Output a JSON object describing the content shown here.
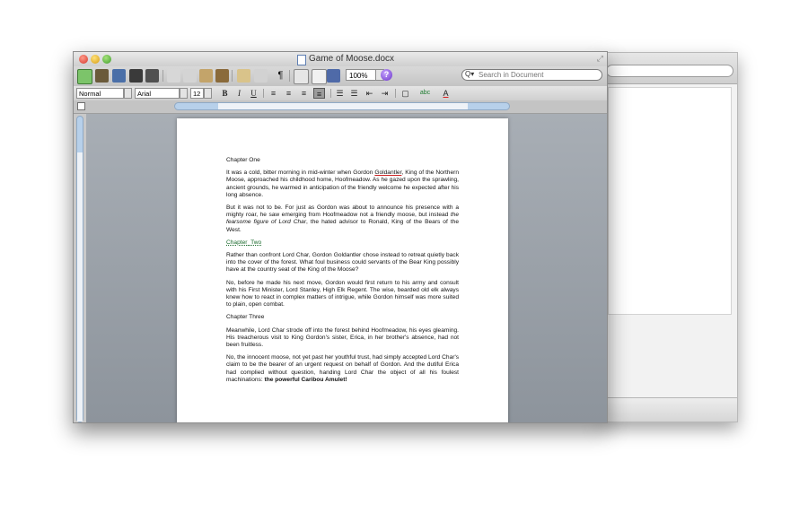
{
  "window": {
    "title": "Game of Moose.docx"
  },
  "toolbar": {
    "zoom": "100%",
    "search_placeholder": "Search in Document"
  },
  "format": {
    "style": "Normal",
    "font": "Arial",
    "size": "12",
    "bold": "B",
    "italic": "I",
    "underline": "U"
  },
  "document": {
    "chapter1_heading": "Chapter One",
    "p1a": "It was a cold, bitter morning in mid-winter when Gordon ",
    "p1_name": "Goldantler",
    "p1b": ", King of the Northern Moose, approached his childhood home, Hoofmeadow. As he gazed upon the sprawling, ancient grounds, he warmed in anticipation of the friendly welcome he expected after his long absence.",
    "p2a": "But it was not to be. For just as Gordon was about to announce his presence with a mighty roar, he saw emerging from Hoofmeadow not a friendly moose, but instead ",
    "p2_em": "the fearsome figure of Lord Char",
    "p2b": ", the hated advisor to Ronald, King of the Bears of the West.",
    "chapter2_heading": "Chapter_Two",
    "p3": "Rather than confront Lord Char, Gordon Goldantler chose instead to retreat quietly back into the cover of the forest. What foul business could servants of the Bear King possibly have at the country seat of the King of the Moose?",
    "p4": "No, before he made his next move, Gordon would first return to his army and consult with his First Minister, Lord Stanley, High Elk Regent. The wise, bearded old elk always knew how to react in complex matters of intrigue, while Gordon himself was more suited to plain, open combat.",
    "chapter3_heading": "Chapter Three",
    "p5": "Meanwhile, Lord Char strode off into the forest behind Hoofmeadow, his eyes gleaming. His treacherous visit to King Gordon's sister, Erica, in her brother's absence, had not been fruitless.",
    "p6a": "No, the innocent moose, not yet past her youthful trust, had simply accepted Lord Char's claim to be the bearer of an urgent request on behalf of Gordon. And the dutiful Erica had complied without question, handing Lord Char the object of all his foulest machinations: ",
    "p6_strong": "the powerful Caribou Amulet!"
  }
}
